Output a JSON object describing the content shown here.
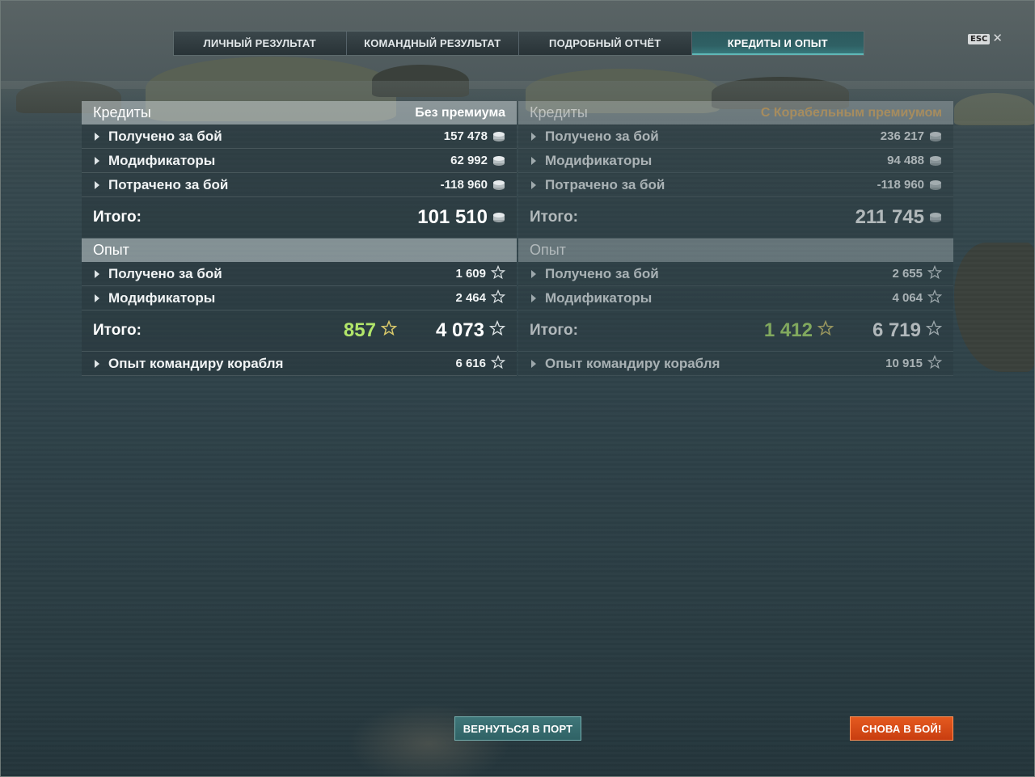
{
  "tabs": [
    {
      "label": "ЛИЧНЫЙ РЕЗУЛЬТАТ",
      "active": false
    },
    {
      "label": "КОМАНДНЫЙ РЕЗУЛЬТАТ",
      "active": false
    },
    {
      "label": "ПОДРОБНЫЙ ОТЧЁТ",
      "active": false
    },
    {
      "label": "КРЕДИТЫ И ОПЫТ",
      "active": true
    }
  ],
  "close": {
    "key_label": "ESC",
    "icon": "close-icon"
  },
  "left": {
    "credits": {
      "title": "Кредиты",
      "subtitle": "Без премиума",
      "rows": [
        {
          "label": "Получено за бой",
          "value": "157 478"
        },
        {
          "label": "Модификаторы",
          "value": "62 992"
        },
        {
          "label": "Потрачено за бой",
          "value": "-118 960"
        }
      ],
      "total_label": "Итого:",
      "total_value": "101 510"
    },
    "xp": {
      "title": "Опыт",
      "rows": [
        {
          "label": "Получено за бой",
          "value": "1 609"
        },
        {
          "label": "Модификаторы",
          "value": "2 464"
        }
      ],
      "total_label": "Итого:",
      "free_value": "857",
      "total_value": "4 073",
      "commander": {
        "label": "Опыт командиру корабля",
        "value": "6 616"
      }
    }
  },
  "right": {
    "credits": {
      "title": "Кредиты",
      "subtitle": "С Корабельным премиумом",
      "rows": [
        {
          "label": "Получено за бой",
          "value": "236 217"
        },
        {
          "label": "Модификаторы",
          "value": "94 488"
        },
        {
          "label": "Потрачено за бой",
          "value": "-118 960"
        }
      ],
      "total_label": "Итого:",
      "total_value": "211 745"
    },
    "xp": {
      "title": "Опыт",
      "rows": [
        {
          "label": "Получено за бой",
          "value": "2 655"
        },
        {
          "label": "Модификаторы",
          "value": "4 064"
        }
      ],
      "total_label": "Итого:",
      "free_value": "1 412",
      "total_value": "6 719",
      "commander": {
        "label": "Опыт командиру корабля",
        "value": "10 915"
      }
    }
  },
  "buttons": {
    "port": "ВЕРНУТЬСЯ В ПОРТ",
    "battle": "СНОВА В БОЙ!"
  },
  "colors": {
    "active_tab": "#2f6064",
    "premium_subtitle": "#e5b266",
    "free_xp": "#b2e66a",
    "battle_button": "#d6461a",
    "port_button": "#34696c"
  }
}
